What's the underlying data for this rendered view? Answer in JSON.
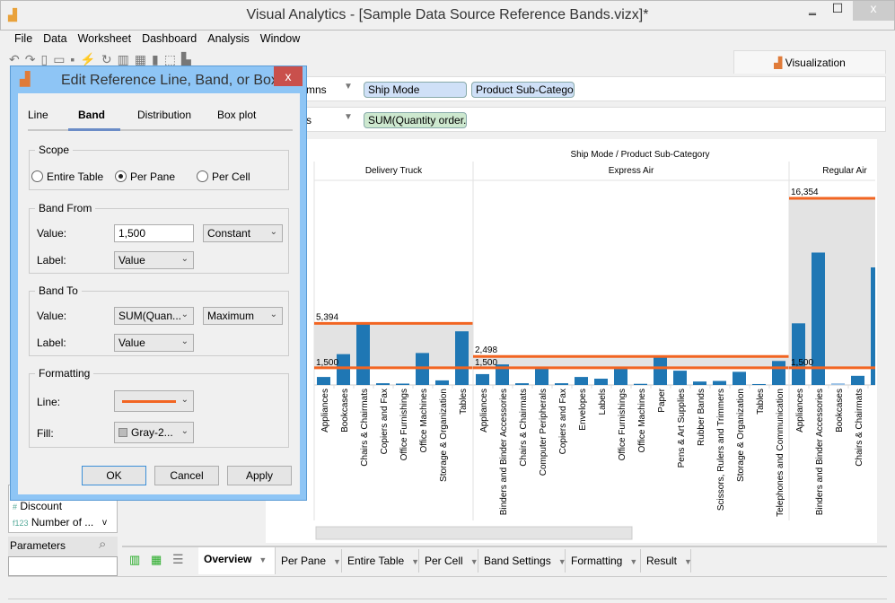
{
  "window": {
    "title": "Visual Analytics - [Sample Data Source Reference Bands.vizx]*",
    "minimize": "‗",
    "maximize": "☐",
    "close": "x"
  },
  "menu": [
    "File",
    "Data",
    "Worksheet",
    "Dashboard",
    "Analysis",
    "Window"
  ],
  "viz_tab": "Visualization",
  "shelves": {
    "columns_label": "mns",
    "columns_pills": [
      "Ship Mode",
      "Product Sub-Category"
    ],
    "rows_label": "s",
    "rows_pills": [
      "SUM(Quantity order..."
    ]
  },
  "left_panel": {
    "fields": [
      "Discount",
      "Number of ..."
    ],
    "parameters_label": "Parameters",
    "parameters_search": ""
  },
  "bottom_tabs": [
    {
      "label": "Overview",
      "active": true
    },
    {
      "label": "Per Pane"
    },
    {
      "label": "Entire Table"
    },
    {
      "label": "Per Cell"
    },
    {
      "label": "Band Settings"
    },
    {
      "label": "Formatting"
    },
    {
      "label": "Result"
    }
  ],
  "dialog": {
    "title": "Edit Reference Line, Band, or Box",
    "close": "x",
    "tabs": [
      {
        "label": "Line"
      },
      {
        "label": "Band",
        "active": true
      },
      {
        "label": "Distribution"
      },
      {
        "label": "Box plot"
      }
    ],
    "scope": {
      "legend": "Scope",
      "options": [
        "Entire Table",
        "Per Pane",
        "Per Cell"
      ],
      "selected": "Per Pane"
    },
    "band_from": {
      "legend": "Band From",
      "value_label": "Value:",
      "value": "1,500",
      "aggregation": "Constant",
      "label_label": "Label:",
      "label": "Value"
    },
    "band_to": {
      "legend": "Band To",
      "value_label": "Value:",
      "value": "SUM(Quan...",
      "aggregation": "Maximum",
      "label_label": "Label:",
      "label": "Value"
    },
    "formatting": {
      "legend": "Formatting",
      "line_label": "Line:",
      "line_color": "#f26522",
      "fill_label": "Fill:",
      "fill": "Gray-2..."
    },
    "buttons": {
      "ok": "OK",
      "cancel": "Cancel",
      "apply": "Apply"
    }
  },
  "chart_data": {
    "type": "bar",
    "title": "Ship Mode / Product Sub-Category",
    "bar_color": "#1f77b4",
    "band_line_color": "#f26522",
    "band_fill": "#e3e3e3",
    "panes": [
      {
        "name": "Delivery Truck",
        "band_from": 1500,
        "band_to": 5394,
        "band_from_label": "1,500",
        "band_to_label": "5,394",
        "categories": [
          "Appliances",
          "Bookcases",
          "Chairs & Chairmats",
          "Copiers and Fax",
          "Office Furnishings",
          "Office Machines",
          "Storage & Organization",
          "Tables"
        ],
        "values": [
          700,
          2700,
          5394,
          150,
          120,
          2800,
          400,
          4700
        ]
      },
      {
        "name": "Express Air",
        "band_from": 1500,
        "band_to": 2498,
        "band_from_label": "1,500",
        "band_to_label": "2,498",
        "categories": [
          "Appliances",
          "Binders and Binder Accessories",
          "Chairs & Chairmats",
          "Computer Peripherals",
          "Copiers and Fax",
          "Envelopes",
          "Labels",
          "Office Furnishings",
          "Office Machines",
          "Paper",
          "Pens & Art Supplies",
          "Rubber Bands",
          "Scissors, Rulers and Trimmers",
          "Storage & Organization",
          "Tables",
          "Telephones and Communication"
        ],
        "values": [
          950,
          1800,
          150,
          1500,
          150,
          700,
          550,
          1500,
          100,
          2498,
          1250,
          300,
          350,
          1150,
          80,
          2100
        ]
      },
      {
        "name": "Regular Air",
        "band_from": 1500,
        "band_to": 16354,
        "band_from_label": "1,500",
        "band_to_label": "16,354",
        "categories": [
          "Appliances",
          "Binders and Binder Accessories",
          "Bookcases",
          "Chairs & Chairmats",
          ""
        ],
        "values": [
          5400,
          11600,
          150,
          800,
          10300
        ]
      }
    ]
  }
}
